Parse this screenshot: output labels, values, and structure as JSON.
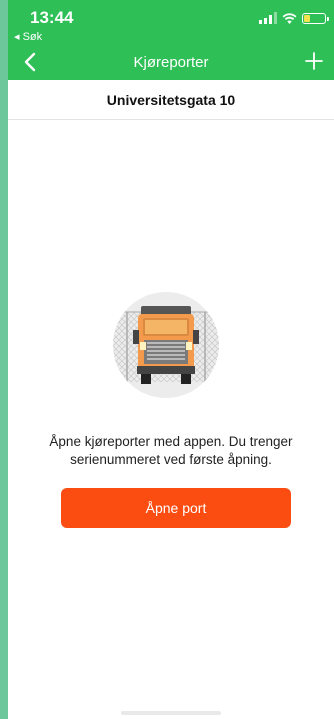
{
  "status_bar": {
    "time": "13:44",
    "back_app": "◂ Søk",
    "battery_level": 0.3
  },
  "nav": {
    "title": "Kjøreporter",
    "back_icon": "chevron-left-icon",
    "add_icon": "plus-icon"
  },
  "subheader": {
    "location": "Universitetsgata 10"
  },
  "empty_state": {
    "illustration": "truck-gate-icon",
    "message": "Åpne kjøreporter med appen. Du trenger serienummeret ved første åpning."
  },
  "actions": {
    "open_port_label": "Åpne port"
  },
  "colors": {
    "brand_green": "#2ebf57",
    "action_orange": "#fb4d12"
  }
}
